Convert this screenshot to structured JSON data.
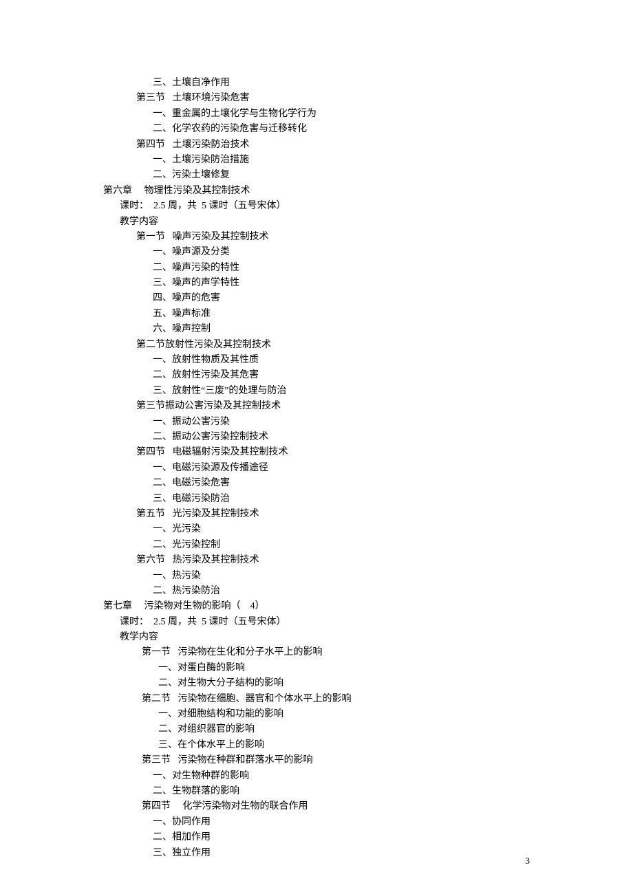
{
  "lines": [
    {
      "cls": "indent-3",
      "text": "三、土壤自净作用"
    },
    {
      "cls": "indent-2",
      "text": "第三节   土壤环境污染危害"
    },
    {
      "cls": "indent-3",
      "text": "一、重金属的土壤化学与生物化学行为"
    },
    {
      "cls": "indent-3",
      "text": "二、化学农药的污染危害与迁移转化"
    },
    {
      "cls": "indent-2",
      "text": "第四节   土壤污染防治技术"
    },
    {
      "cls": "indent-3",
      "text": "一、土壤污染防治措施"
    },
    {
      "cls": "indent-3",
      "text": "二、污染土壤修复"
    },
    {
      "cls": "indent-0",
      "text": "第六章     物理性污染及其控制技术"
    },
    {
      "cls": "indent-1",
      "text": "课时：  2.5 周，共  5 课时（五号宋体）"
    },
    {
      "cls": "indent-1",
      "text": "教学内容"
    },
    {
      "cls": "indent-2",
      "text": "第一节   噪声污染及其控制技术"
    },
    {
      "cls": "indent-3",
      "text": "一、噪声源及分类"
    },
    {
      "cls": "indent-3",
      "text": "二、噪声污染的特性"
    },
    {
      "cls": "indent-3",
      "text": "三、噪声的声学特性"
    },
    {
      "cls": "indent-3",
      "text": "四、噪声的危害"
    },
    {
      "cls": "indent-3",
      "text": "五、噪声标准"
    },
    {
      "cls": "indent-3",
      "text": "六、噪声控制"
    },
    {
      "cls": "indent-2",
      "text": "第二节放射性污染及其控制技术"
    },
    {
      "cls": "indent-3",
      "text": "一、放射性物质及其性质"
    },
    {
      "cls": "indent-3",
      "text": "二、放射性污染及其危害"
    },
    {
      "cls": "indent-3",
      "text": "三、放射性“三废”的处理与防治"
    },
    {
      "cls": "indent-2",
      "text": "第三节振动公害污染及其控制技术"
    },
    {
      "cls": "indent-3",
      "text": "一、振动公害污染"
    },
    {
      "cls": "indent-3",
      "text": "二、振动公害污染控制技术"
    },
    {
      "cls": "indent-2",
      "text": "第四节   电磁辐射污染及其控制技术"
    },
    {
      "cls": "indent-3",
      "text": "一、电磁污染源及传播途径"
    },
    {
      "cls": "indent-3",
      "text": "二、电磁污染危害"
    },
    {
      "cls": "indent-3",
      "text": "三、电磁污染防治"
    },
    {
      "cls": "indent-2",
      "text": "第五节   光污染及其控制技术"
    },
    {
      "cls": "indent-3",
      "text": "一、光污染"
    },
    {
      "cls": "indent-3",
      "text": "二、光污染控制"
    },
    {
      "cls": "indent-2",
      "text": "第六节   热污染及其控制技术"
    },
    {
      "cls": "indent-3",
      "text": "一、热污染"
    },
    {
      "cls": "indent-3",
      "text": "二、热污染防治"
    },
    {
      "cls": "indent-0",
      "text": "第七章     污染物对生物的影响（    4）"
    },
    {
      "cls": "indent-1",
      "text": "课时：  2.5 周，共  5 课时（五号宋体）"
    },
    {
      "cls": "indent-1",
      "text": "教学内容"
    },
    {
      "cls": "indent-2b",
      "text": "第一节   污染物在生化和分子水平上的影响"
    },
    {
      "cls": "indent-3b",
      "text": "一、对蛋白酶的影响"
    },
    {
      "cls": "indent-3b",
      "text": "二、对生物大分子结构的影响"
    },
    {
      "cls": "indent-2b",
      "text": "第二节   污染物在细胞、器官和个体水平上的影响"
    },
    {
      "cls": "indent-3b",
      "text": "一、对细胞结构和功能的影响"
    },
    {
      "cls": "indent-3b",
      "text": "二、对组织器官的影响"
    },
    {
      "cls": "indent-3b",
      "text": "三、在个体水平上的影响"
    },
    {
      "cls": "indent-2b",
      "text": "第三节   污染物在种群和群落水平的影响"
    },
    {
      "cls": "indent-3",
      "text": "一、对生物种群的影响"
    },
    {
      "cls": "indent-3",
      "text": "二、生物群落的影响"
    },
    {
      "cls": "indent-2b",
      "text": "第四节     化学污染物对生物的联合作用"
    },
    {
      "cls": "indent-3",
      "text": "一、协同作用"
    },
    {
      "cls": "indent-3",
      "text": "二、相加作用"
    },
    {
      "cls": "indent-3",
      "text": "三、独立作用"
    }
  ],
  "page_number": "3"
}
